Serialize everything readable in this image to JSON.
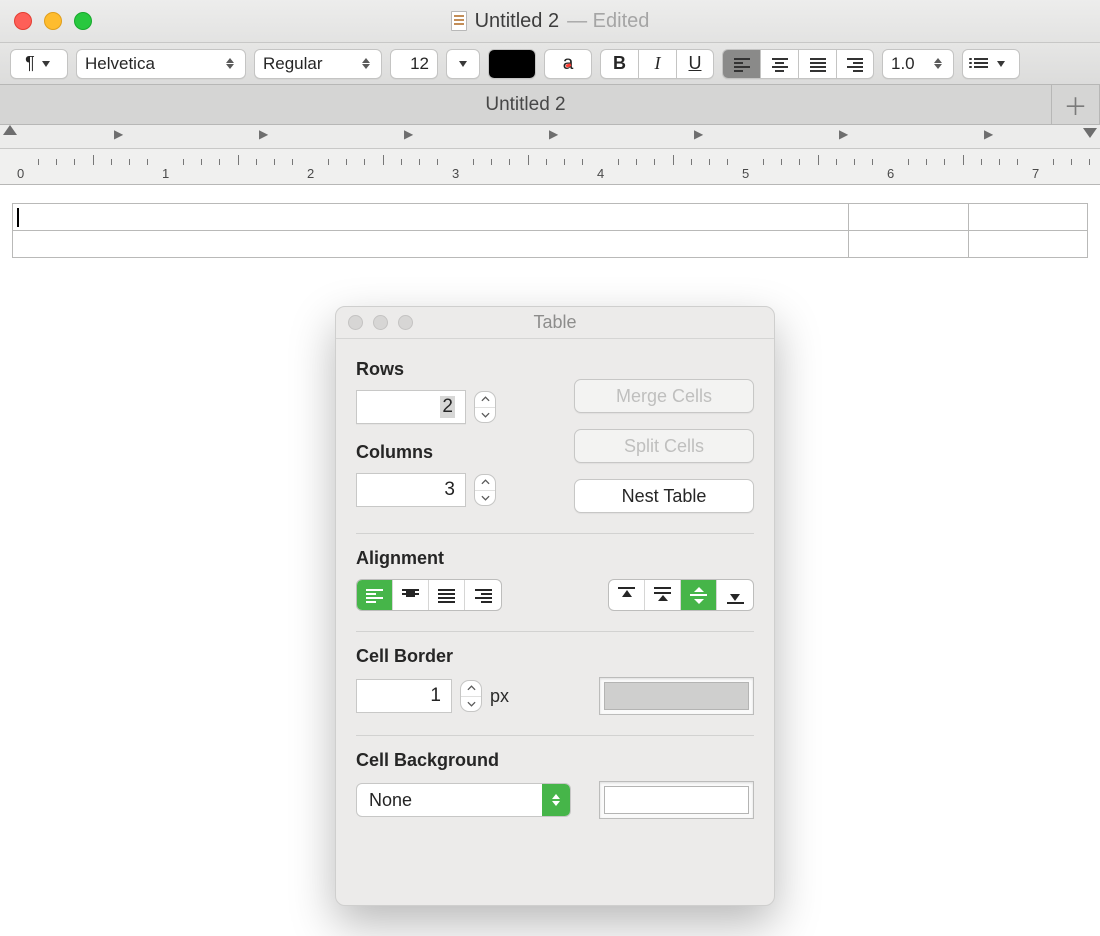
{
  "window": {
    "title": "Untitled 2",
    "status": "Edited"
  },
  "toolbar": {
    "pilcrow": "¶",
    "font": "Helvetica",
    "style": "Regular",
    "size": "12",
    "spacing": "1.0"
  },
  "tab": {
    "label": "Untitled 2"
  },
  "ruler": {
    "labels": [
      "0",
      "1",
      "2",
      "3",
      "4",
      "5",
      "6",
      "7"
    ]
  },
  "panel": {
    "title": "Table",
    "rows_label": "Rows",
    "rows_value": "2",
    "columns_label": "Columns",
    "columns_value": "3",
    "merge": "Merge Cells",
    "split": "Split Cells",
    "nest": "Nest Table",
    "alignment_label": "Alignment",
    "border_label": "Cell Border",
    "border_value": "1",
    "border_unit": "px",
    "bg_label": "Cell Background",
    "bg_value": "None"
  }
}
